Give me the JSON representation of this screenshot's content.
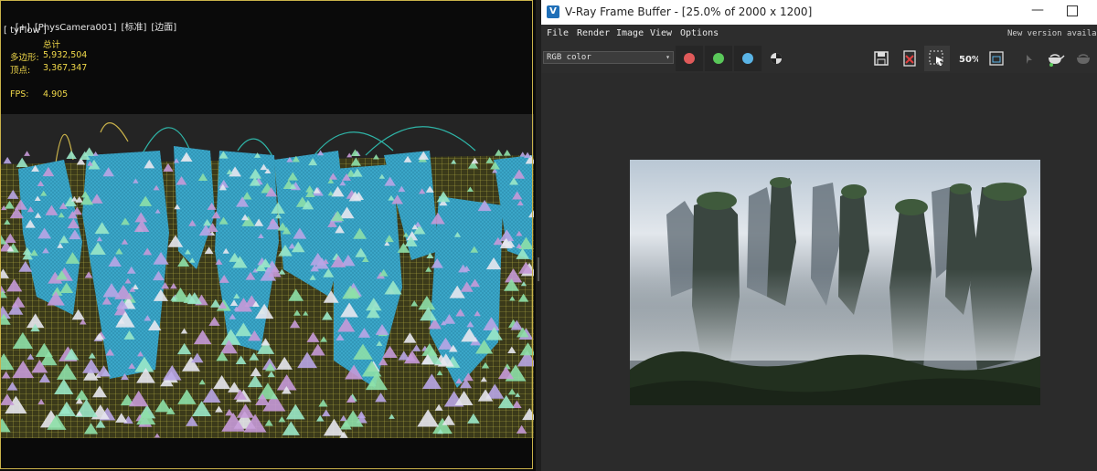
{
  "viewport": {
    "header_items": [
      "[+]",
      "[PhysCamera001]",
      "[标准]",
      "[边面]"
    ],
    "modifier": "[ tyFlow ]",
    "stats": {
      "total_label": "总计",
      "polys_label": "多边形:",
      "polys_value": "5,932,504",
      "verts_label": "顶点:",
      "verts_value": "3,367,347",
      "fps_label": "FPS:",
      "fps_value": "4.905"
    },
    "colors": {
      "border": "#c9b24a",
      "stats_text": "#f0d84a",
      "mesh_blue": "#3aa6c8",
      "mesh_pink": "#c79ad8",
      "mesh_green": "#8ee0a8"
    }
  },
  "vfb": {
    "title": "V-Ray Frame Buffer - [25.0% of 2000 x 1200]",
    "logo_icon": "vray-logo-icon",
    "window_controls": {
      "minimize": "—"
    },
    "menu": [
      "File",
      "Render",
      "Image",
      "View",
      "Options"
    ],
    "new_version_text": "New version availa",
    "channel_select": {
      "value": "RGB color",
      "arrow": "▾"
    },
    "channel_buttons": [
      {
        "name": "red-channel-button",
        "color": "#e05a5a"
      },
      {
        "name": "green-channel-button",
        "color": "#5ac85a"
      },
      {
        "name": "blue-channel-button",
        "color": "#5ab4e6"
      }
    ],
    "toolbar_icons": [
      "alpha-channel-icon",
      "save-icon",
      "clear-image-icon",
      "region-select-icon",
      "zoom-50-icon",
      "display-lut-icon",
      "track-mouse-icon",
      "render-teapot-icon",
      "render-interactive-icon"
    ],
    "zoom_badge": "50%",
    "render": {
      "description_icon": "rendered-landscape-image",
      "colors": {
        "sky": "#cdd7e0",
        "rock": "#2f3a34",
        "fog": "#9aa3a8",
        "foliage": "#3e5a3a"
      }
    }
  }
}
